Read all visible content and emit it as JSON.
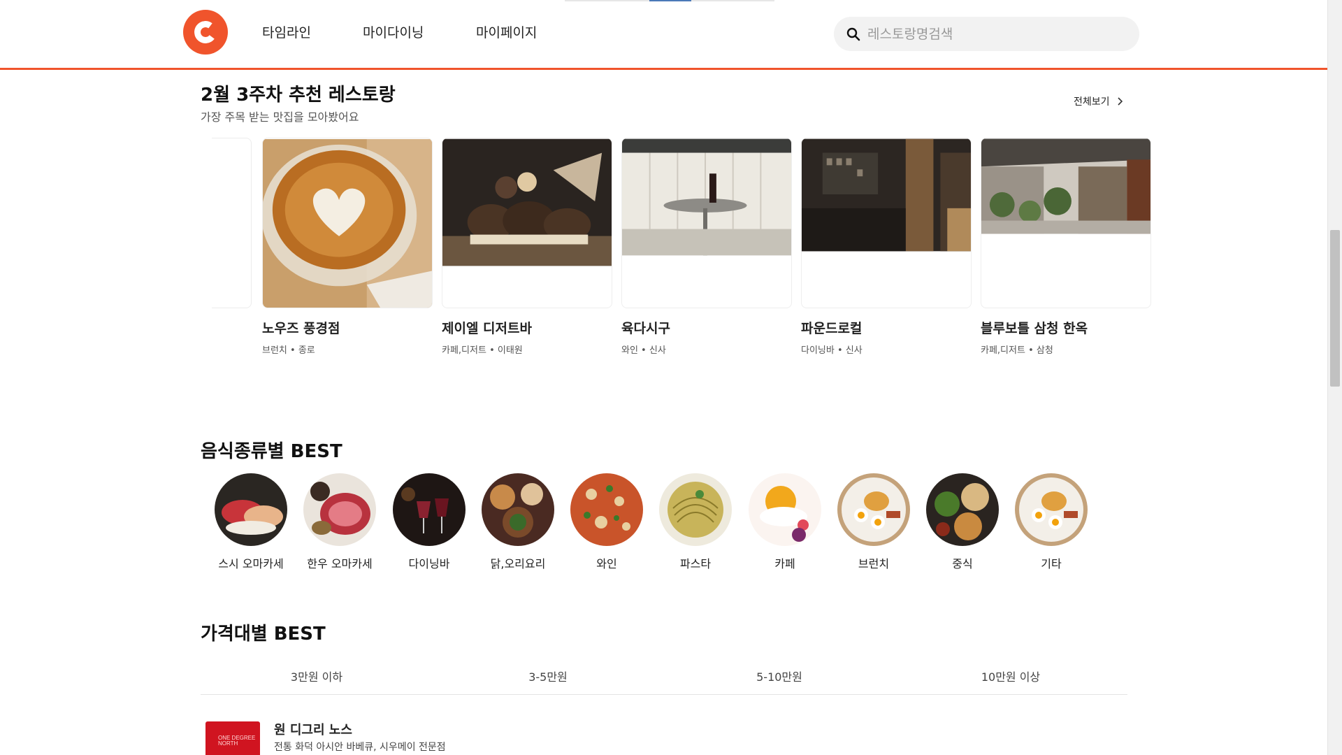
{
  "header": {
    "nav": [
      "타임라인",
      "마이다이닝",
      "마이페이지"
    ],
    "search_placeholder": "레스토랑명검색"
  },
  "recommend": {
    "title": "2월 3주차 추천 레스토랑",
    "subtitle": "가장 주목 받는 맛집을 모아봤어요",
    "see_all": "전체보기",
    "cards": [
      {
        "name": "노우즈 풍경점",
        "meta": "브런치 • 종로",
        "photo": "latte-art"
      },
      {
        "name": "제이엘 디저트바",
        "meta": "카페,디저트 • 이태원",
        "photo": "chocolate-dessert"
      },
      {
        "name": "육다시구",
        "meta": "와인 • 신사",
        "photo": "wine-booth"
      },
      {
        "name": "파운드로컬",
        "meta": "다이닝바 • 신사",
        "photo": "dark-bar"
      },
      {
        "name": "블루보틀 삼청 한옥",
        "meta": "카페,디저트 • 삼청",
        "photo": "hanok-courtyard"
      }
    ]
  },
  "food_best": {
    "title": "음식종류별 BEST",
    "categories": [
      "스시 오마카세",
      "한우 오마카세",
      "다이닝바",
      "닭,오리요리",
      "와인",
      "파스타",
      "카페",
      "브런치",
      "중식",
      "기타"
    ]
  },
  "price_best": {
    "title": "가격대별 BEST",
    "tabs": [
      "3만원 이하",
      "3-5만원",
      "5-10만원",
      "10만원 이상"
    ],
    "first_item": {
      "name": "원 디그리 노스",
      "desc": "전통 화덕 아시안 바베큐, 시우메이 전문점",
      "thumb_text": "ONE DEGREE NORTH"
    }
  },
  "colors": {
    "accent": "#f0542c"
  }
}
